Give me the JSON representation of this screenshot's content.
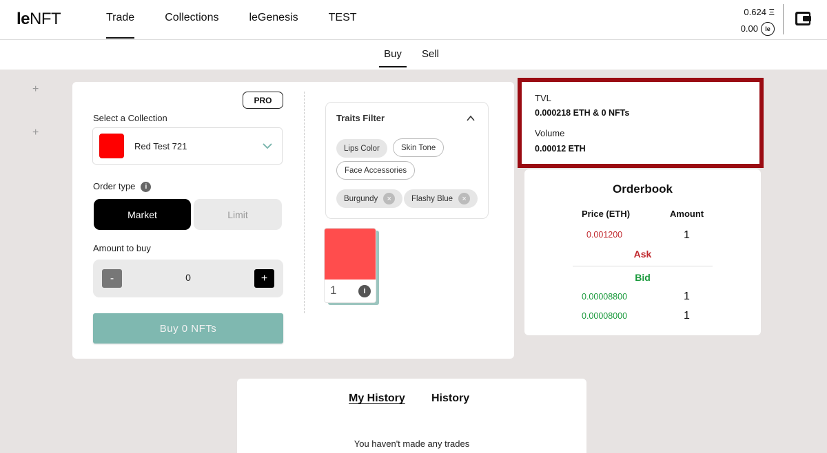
{
  "header": {
    "logo_bold": "le",
    "logo_rest": "NFT",
    "nav": [
      {
        "label": "Trade"
      },
      {
        "label": "Collections"
      },
      {
        "label": "leGenesis"
      },
      {
        "label": "TEST"
      }
    ],
    "eth_balance": "0.624 Ξ",
    "le_balance": "0.00",
    "le_coin_label": "le"
  },
  "subtabs": {
    "buy": "Buy",
    "sell": "Sell"
  },
  "form": {
    "pro_label": "PRO",
    "select_label": "Select a Collection",
    "collection_name": "Red Test 721",
    "collection_color": "#ff0000",
    "order_type_label": "Order type",
    "market_label": "Market",
    "limit_label": "Limit",
    "amount_label": "Amount to buy",
    "minus": "-",
    "plus": "+",
    "amount_value": "0",
    "buy_button": "Buy 0 NFTs"
  },
  "traits": {
    "title": "Traits Filter",
    "chips": [
      "Lips Color",
      "Skin Tone",
      "Face Accessories"
    ],
    "selected": [
      "Burgundy",
      "Flashy Blue"
    ]
  },
  "nft": {
    "count": "1",
    "info": "i",
    "color": "#ff4d4d"
  },
  "stats": {
    "tvl_label": "TVL",
    "tvl_value": "0.000218 ETH & 0 NFTs",
    "volume_label": "Volume",
    "volume_value": "0.00012 ETH",
    "highlight_color": "#9a0b12"
  },
  "orderbook": {
    "title": "Orderbook",
    "price_header": "Price (ETH)",
    "amount_header": "Amount",
    "asks": [
      {
        "price": "0.001200",
        "amount": "1"
      }
    ],
    "ask_label": "Ask",
    "bid_label": "Bid",
    "bids": [
      {
        "price": "0.00008800",
        "amount": "1"
      },
      {
        "price": "0.00008000",
        "amount": "1"
      }
    ],
    "ask_color": "#c0282d",
    "bid_color": "#1a9a3c"
  },
  "history": {
    "my_history": "My History",
    "history": "History",
    "empty": "You haven't made any trades"
  }
}
